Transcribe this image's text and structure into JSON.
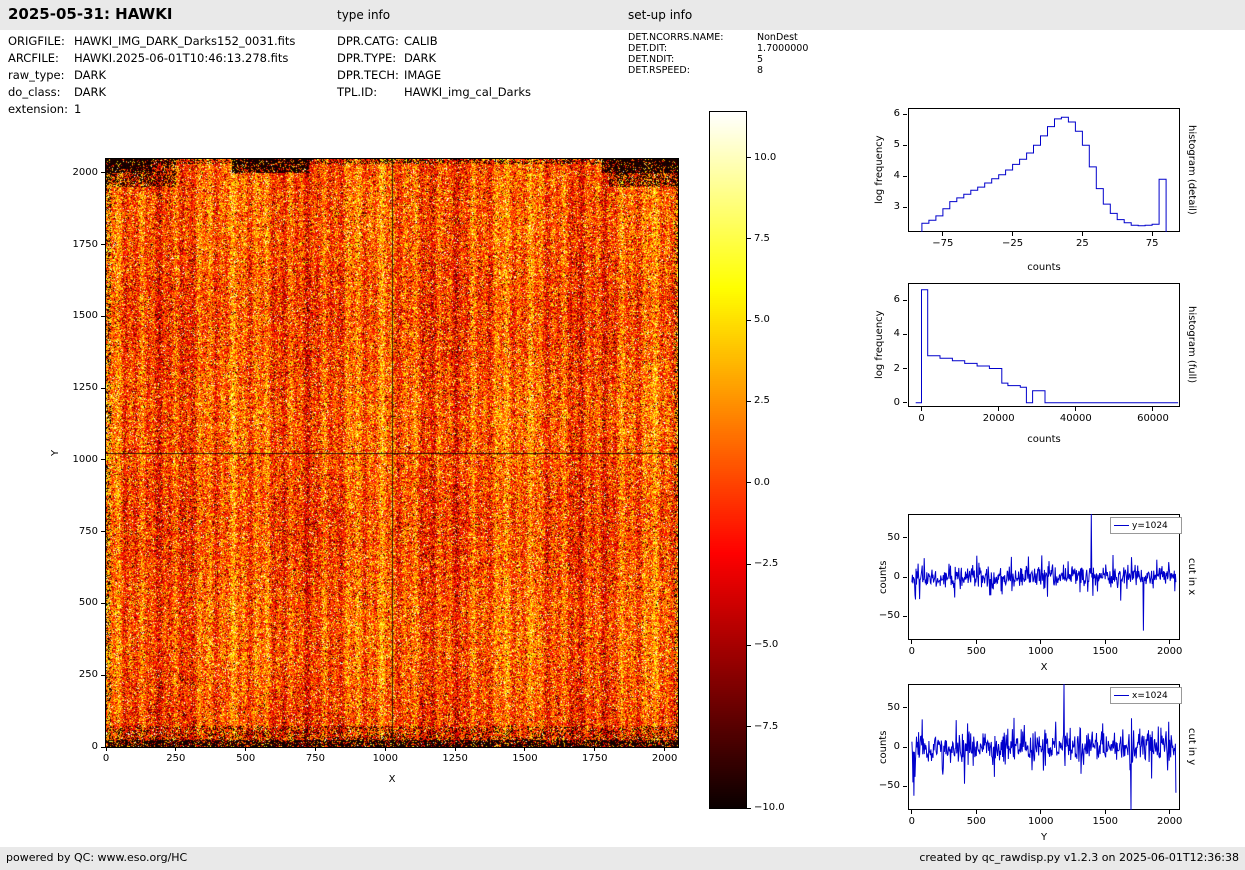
{
  "header": {
    "title": "2025-05-31: HAWKI",
    "type_info_label": "type info",
    "setup_info_label": "set-up info"
  },
  "file_info": [
    {
      "label": "ORIGFILE:",
      "value": "HAWKI_IMG_DARK_Darks152_0031.fits"
    },
    {
      "label": "ARCFILE:",
      "value": "HAWKI.2025-06-01T10:46:13.278.fits"
    },
    {
      "label": "raw_type:",
      "value": "DARK"
    },
    {
      "label": "do_class:",
      "value": "DARK"
    },
    {
      "label": "extension:",
      "value": "1"
    }
  ],
  "type_info": [
    {
      "label": "DPR.CATG:",
      "value": "CALIB"
    },
    {
      "label": "DPR.TYPE:",
      "value": "DARK"
    },
    {
      "label": "DPR.TECH:",
      "value": "IMAGE"
    },
    {
      "label": "TPL.ID:",
      "value": "HAWKI_img_cal_Darks"
    }
  ],
  "setup_info": [
    {
      "label": "DET.NCORRS.NAME:",
      "value": "NonDest"
    },
    {
      "label": "DET.DIT:",
      "value": "1.7000000"
    },
    {
      "label": "DET.NDIT:",
      "value": "5"
    },
    {
      "label": "DET.RSPEED:",
      "value": "8"
    }
  ],
  "footer": {
    "left": "powered by QC: www.eso.org/HC",
    "right": "created by qc_rawdisp.py v1.2.3 on 2025-06-01T12:36:38"
  },
  "chart_data": [
    {
      "id": "main_image",
      "type": "heatmap",
      "xlabel": "X",
      "ylabel": "Y",
      "xlim": [
        0,
        2048
      ],
      "ylim": [
        0,
        2048
      ],
      "xticks": [
        0,
        250,
        500,
        750,
        1000,
        1250,
        1500,
        1750,
        2000
      ],
      "yticks": [
        0,
        250,
        500,
        750,
        1000,
        1250,
        1500,
        1750,
        2000
      ],
      "colormap": "hot",
      "vmin": -10.0,
      "vmax": 11.4,
      "crosshair_x": 1024,
      "crosshair_y": 1024,
      "description": "2048x2048 HAWKI raw dark frame: noisy orange/red field with bright yellow/white and dark speckles, black speckle clusters along top and bottom edges, faint vertical column striping, thin crosshair lines at X=1024 and Y=1024"
    },
    {
      "id": "colorbar",
      "type": "colorbar",
      "colormap": "hot",
      "vmin": -10.0,
      "vmax": 11.4,
      "ticks": [
        10.0,
        7.5,
        5.0,
        2.5,
        0.0,
        -2.5,
        -5.0,
        -7.5,
        -10.0
      ]
    },
    {
      "id": "hist_detail",
      "type": "bar",
      "right_label": "histogram (detail)",
      "xlabel": "counts",
      "ylabel": "log frequency",
      "xlim": [
        -100,
        95
      ],
      "ylim": [
        2.2,
        6.2
      ],
      "xticks": [
        -75,
        -25,
        25,
        75
      ],
      "yticks": [
        3,
        4,
        5,
        6
      ],
      "bin_start": -90,
      "bin_width": 5,
      "values": [
        2.48,
        2.58,
        2.72,
        2.95,
        3.18,
        3.3,
        3.42,
        3.55,
        3.65,
        3.78,
        3.92,
        4.05,
        4.2,
        4.38,
        4.55,
        4.75,
        5.0,
        5.3,
        5.6,
        5.85,
        5.9,
        5.75,
        5.45,
        5.0,
        4.3,
        3.6,
        3.1,
        2.8,
        2.6,
        2.5,
        2.42,
        2.4,
        2.42,
        2.45,
        3.9
      ],
      "color": "#0000cc"
    },
    {
      "id": "hist_full",
      "type": "bar",
      "right_label": "histogram (full)",
      "xlabel": "counts",
      "ylabel": "log frequency",
      "xlim": [
        -3500,
        67000
      ],
      "ylim": [
        -0.25,
        7.0
      ],
      "xticks": [
        0,
        20000,
        40000,
        60000
      ],
      "yticks": [
        0,
        2,
        4,
        6
      ],
      "steps": [
        [
          -1500,
          0
        ],
        [
          0,
          0
        ],
        [
          0,
          6.6
        ],
        [
          1600,
          6.6
        ],
        [
          1600,
          2.75
        ],
        [
          4800,
          2.75
        ],
        [
          4800,
          2.6
        ],
        [
          8000,
          2.6
        ],
        [
          8000,
          2.45
        ],
        [
          11200,
          2.45
        ],
        [
          11200,
          2.3
        ],
        [
          14400,
          2.3
        ],
        [
          14400,
          2.15
        ],
        [
          17600,
          2.15
        ],
        [
          17600,
          2.0
        ],
        [
          20800,
          2.0
        ],
        [
          20800,
          1.15
        ],
        [
          22400,
          1.15
        ],
        [
          22400,
          1.0
        ],
        [
          25600,
          1.0
        ],
        [
          25600,
          0.9
        ],
        [
          27200,
          0.9
        ],
        [
          27200,
          0
        ],
        [
          28800,
          0
        ],
        [
          28800,
          0.7
        ],
        [
          32000,
          0.7
        ],
        [
          32000,
          0
        ],
        [
          66500,
          0
        ]
      ],
      "color": "#0000cc"
    },
    {
      "id": "cut_x",
      "type": "line",
      "legend": "y=1024",
      "right_label": "cut in x",
      "xlabel": "X",
      "ylabel": "counts",
      "xlim": [
        -30,
        2080
      ],
      "ylim": [
        -80,
        80
      ],
      "xticks": [
        0,
        500,
        1000,
        1500,
        2000
      ],
      "yticks": [
        -50,
        0,
        50
      ],
      "noise_sigma": 7,
      "seed": 42,
      "spikes": [
        [
          60,
          -28
        ],
        [
          95,
          24
        ],
        [
          330,
          -26
        ],
        [
          520,
          18
        ],
        [
          700,
          -22
        ],
        [
          905,
          26
        ],
        [
          1050,
          -25
        ],
        [
          1210,
          20
        ],
        [
          1390,
          120
        ],
        [
          1402,
          -24
        ],
        [
          1560,
          28
        ],
        [
          1620,
          -30
        ],
        [
          1795,
          -68
        ],
        [
          1900,
          22
        ],
        [
          2040,
          -18
        ]
      ],
      "color": "#0000cc"
    },
    {
      "id": "cut_y",
      "type": "line",
      "legend": "x=1024",
      "right_label": "cut in y",
      "xlabel": "Y",
      "ylabel": "counts",
      "xlim": [
        -30,
        2080
      ],
      "ylim": [
        -80,
        80
      ],
      "xticks": [
        0,
        500,
        1000,
        1500,
        2000
      ],
      "yticks": [
        -50,
        0,
        50
      ],
      "noise_sigma": 10,
      "seed": 1337,
      "spikes": [
        [
          6,
          -45
        ],
        [
          14,
          -62
        ],
        [
          22,
          -38
        ],
        [
          80,
          35
        ],
        [
          240,
          -35
        ],
        [
          430,
          30
        ],
        [
          640,
          -38
        ],
        [
          870,
          28
        ],
        [
          1020,
          -30
        ],
        [
          1180,
          90
        ],
        [
          1310,
          -34
        ],
        [
          1480,
          30
        ],
        [
          1700,
          -100
        ],
        [
          1860,
          -40
        ],
        [
          1990,
          32
        ],
        [
          2046,
          -58
        ]
      ],
      "color": "#0000cc"
    }
  ]
}
